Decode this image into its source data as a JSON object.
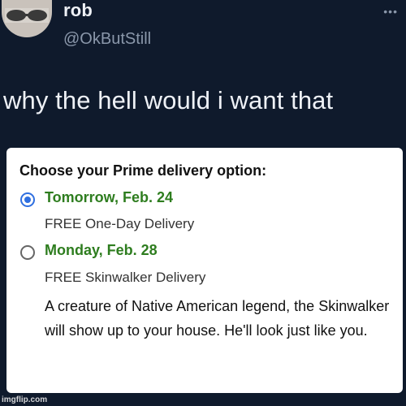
{
  "tweet": {
    "author_name": "rob",
    "author_handle": "@OkButStill",
    "text": "why the hell would i want that"
  },
  "delivery_card": {
    "title": "Choose your Prime delivery option:",
    "options": [
      {
        "date": "Tomorrow, Feb. 24",
        "description": "FREE One-Day Delivery",
        "selected": true
      },
      {
        "date": "Monday, Feb. 28",
        "description": "FREE Skinwalker Delivery",
        "note": "A creature of Native American legend, the Skinwalker will show up to your house. He'll look just like you.",
        "selected": false
      }
    ]
  },
  "watermark": "imgflip.com",
  "colors": {
    "background": "#0f1a2c",
    "date_green": "#2e7d1f",
    "radio_blue": "#2f6fe0",
    "handle_gray": "#8a97aa"
  },
  "icons": {
    "more": "more-horizontal-icon"
  }
}
